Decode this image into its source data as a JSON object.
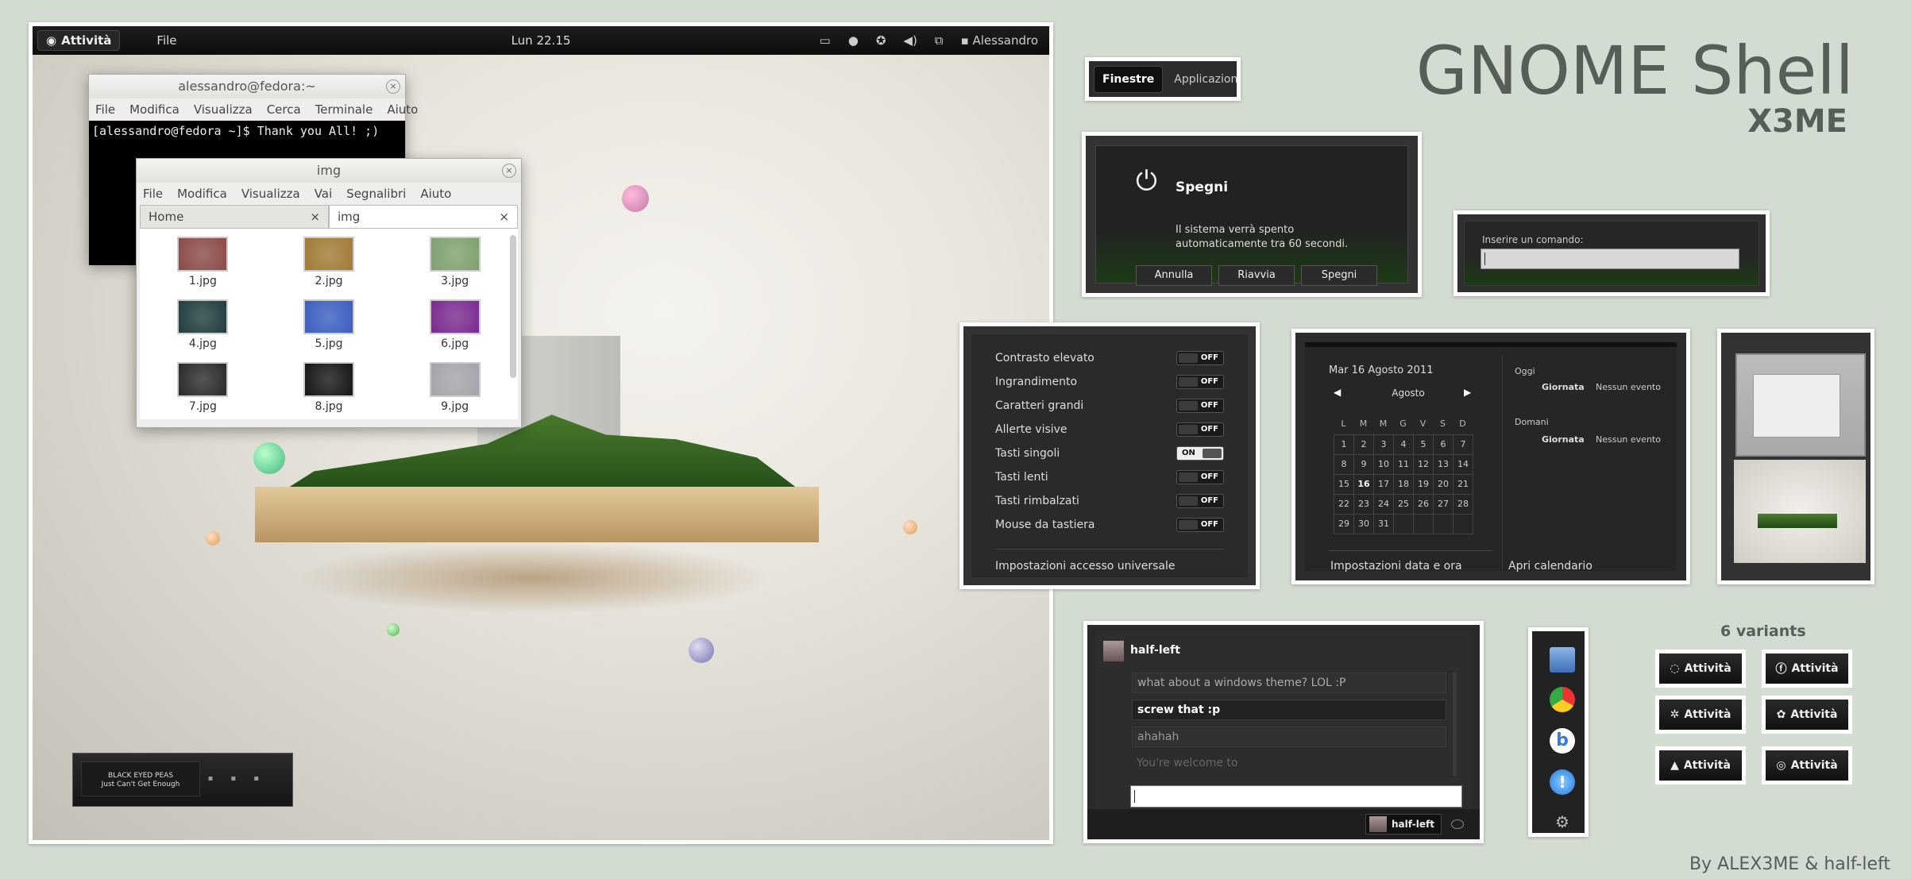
{
  "header": {
    "title": "GNOME Shell",
    "subtitle": "X3ME",
    "credit": "By ALEX3ME & half-left",
    "variants_title": "6 variants"
  },
  "desktop": {
    "topbar": {
      "activities": "Attività",
      "file_menu": "File",
      "clock": "Lun 22.15",
      "user": "Alessandro"
    },
    "terminal": {
      "title": "alessandro@fedora:~",
      "menu": [
        "File",
        "Modifica",
        "Visualizza",
        "Cerca",
        "Terminale",
        "Aiuto"
      ],
      "line": "[alessandro@fedora ~]$ Thank you All! ;)"
    },
    "nautilus": {
      "title": "img",
      "menu": [
        "File",
        "Modifica",
        "Visualizza",
        "Vai",
        "Segnalibri",
        "Aiuto"
      ],
      "tabs": [
        {
          "label": "Home",
          "close": "×"
        },
        {
          "label": "img",
          "close": "×"
        }
      ],
      "files": [
        {
          "name": "1.jpg",
          "color": "#8a4a46"
        },
        {
          "name": "2.jpg",
          "color": "#a07a34"
        },
        {
          "name": "3.jpg",
          "color": "#7ea06e"
        },
        {
          "name": "4.jpg",
          "color": "#1f3c3c"
        },
        {
          "name": "5.jpg",
          "color": "#3a5ec0"
        },
        {
          "name": "6.jpg",
          "color": "#7a2a8e"
        },
        {
          "name": "7.jpg",
          "color": "#2a2a2a"
        },
        {
          "name": "8.jpg",
          "color": "#151515"
        },
        {
          "name": "9.jpg",
          "color": "#a6a2aa"
        }
      ]
    },
    "music": {
      "artist": "BLACK EYED PEAS",
      "song": "Just Can't Get Enough"
    }
  },
  "switcher": {
    "windows": "Finestre",
    "apps": "Applicazioni"
  },
  "shutdown": {
    "title": "Spegni",
    "message1": "Il sistema verrà spento",
    "message2": "automaticamente tra 60 secondi.",
    "cancel": "Annulla",
    "restart": "Riavvia",
    "shutdown": "Spegni"
  },
  "run": {
    "label": "Inserire un comando:"
  },
  "a11y": {
    "items": [
      {
        "label": "Contrasto elevato",
        "state": "OFF"
      },
      {
        "label": "Ingrandimento",
        "state": "OFF"
      },
      {
        "label": "Caratteri grandi",
        "state": "OFF"
      },
      {
        "label": "Allerte visive",
        "state": "OFF"
      },
      {
        "label": "Tasti singoli",
        "state": "ON"
      },
      {
        "label": "Tasti lenti",
        "state": "OFF"
      },
      {
        "label": "Tasti rimbalzati",
        "state": "OFF"
      },
      {
        "label": "Mouse da tastiera",
        "state": "OFF"
      }
    ],
    "settings": "Impostazioni accesso universale"
  },
  "calendar": {
    "date": "Mar 16 Agosto 2011",
    "month": "Agosto",
    "weekdays": [
      "L",
      "M",
      "M",
      "G",
      "V",
      "S",
      "D"
    ],
    "days": [
      "1",
      "2",
      "3",
      "4",
      "5",
      "6",
      "7",
      "8",
      "9",
      "10",
      "11",
      "12",
      "13",
      "14",
      "15",
      "16",
      "17",
      "18",
      "19",
      "20",
      "21",
      "22",
      "23",
      "24",
      "25",
      "26",
      "27",
      "28",
      "29",
      "30",
      "31",
      "",
      "",
      "",
      ""
    ],
    "today": "16",
    "today_label": "Oggi",
    "tomorrow_label": "Domani",
    "allday": "Giornata",
    "no_event": "Nessun evento",
    "settings": "Impostazioni data e ora",
    "open": "Apri calendario"
  },
  "chat": {
    "user": "half-left",
    "messages": [
      "what about a windows theme? LOL :P",
      "screw that :p",
      "ahahah",
      "You're welcome to"
    ],
    "footer_user": "half-left"
  },
  "variants": {
    "label": "Attività"
  }
}
